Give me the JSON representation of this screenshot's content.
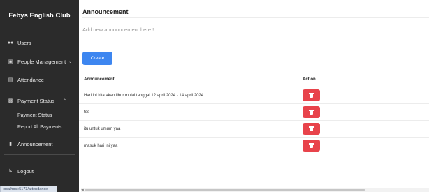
{
  "sidebar": {
    "brand": "Febys English Club",
    "items": {
      "users": {
        "label": "Users",
        "icon": "users-icon"
      },
      "people": {
        "label": "People Management",
        "icon": "id-card-icon"
      },
      "attendance": {
        "label": "Attendance",
        "icon": "book-open-icon"
      },
      "payment": {
        "label": "Payment Status",
        "icon": "money-icon"
      },
      "payment_sub1": {
        "label": "Payment Status"
      },
      "payment_sub2": {
        "label": "Report All Payments"
      },
      "announcement": {
        "label": "Announcement",
        "icon": "comment-icon"
      },
      "logout": {
        "label": "Logout",
        "icon": "sign-out-icon"
      }
    }
  },
  "status_url": "localhost:5173/attendance",
  "main": {
    "title": "Announcement",
    "input_placeholder": "Add new announcement here !",
    "create_label": "Create",
    "table": {
      "headers": {
        "announcement": "Announcement",
        "action": "Action"
      },
      "rows": [
        {
          "text": "Hari ini kita akan libur mulai tanggal 12 april 2024 - 14 april 2024"
        },
        {
          "text": "tes"
        },
        {
          "text": "itu untuk umum yaa"
        },
        {
          "text": "masuk hari ini yaa"
        }
      ]
    }
  },
  "colors": {
    "sidebar_bg": "#2b2b2b",
    "primary": "#3d86f0",
    "danger": "#e8434b"
  }
}
